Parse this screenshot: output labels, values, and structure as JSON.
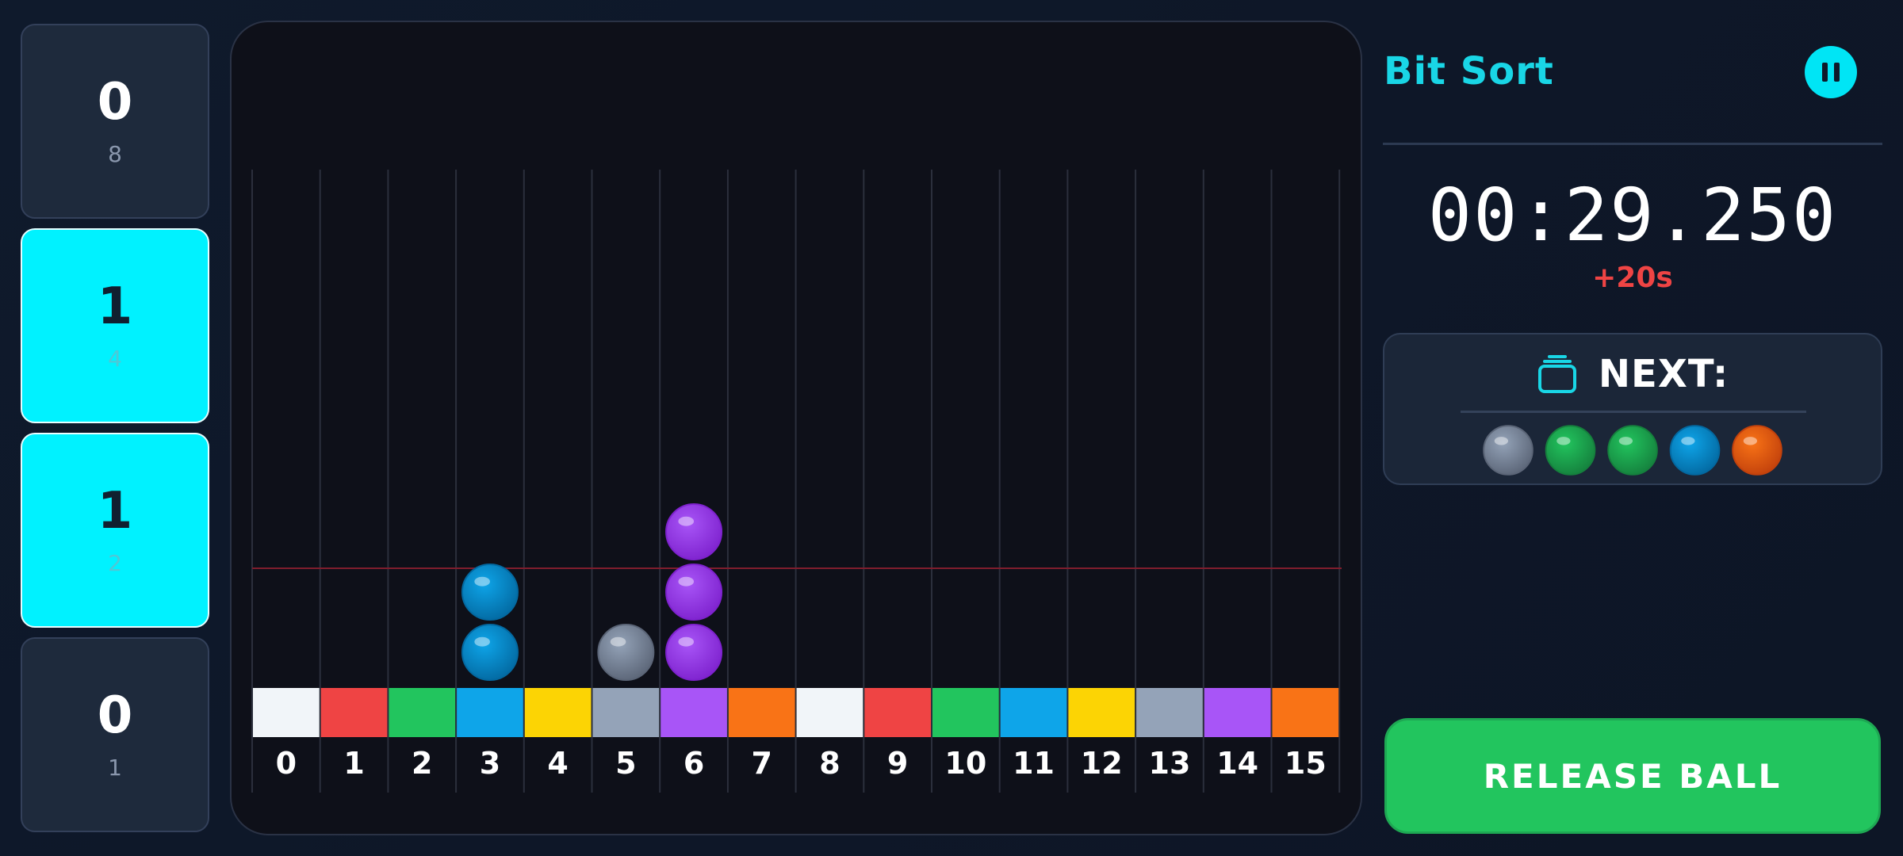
{
  "app": {
    "title": "Bit Sort"
  },
  "bits": [
    {
      "value": "0",
      "weight": "8",
      "active": false
    },
    {
      "value": "1",
      "weight": "4",
      "active": true
    },
    {
      "value": "1",
      "weight": "2",
      "active": true
    },
    {
      "value": "0",
      "weight": "1",
      "active": false
    }
  ],
  "timer": {
    "display": "00:29.250",
    "penalty": "+20s"
  },
  "next": {
    "label": "NEXT:",
    "balls": [
      "gray",
      "green",
      "green",
      "blue",
      "orange"
    ]
  },
  "release_button": {
    "label": "RELEASE BALL"
  },
  "board": {
    "columns": [
      {
        "label": "0",
        "color": "#f1f5f9"
      },
      {
        "label": "1",
        "color": "#ef4444"
      },
      {
        "label": "2",
        "color": "#22c55e"
      },
      {
        "label": "3",
        "color": "#0ea5e9"
      },
      {
        "label": "4",
        "color": "#fcd404"
      },
      {
        "label": "5",
        "color": "#94a3b8"
      },
      {
        "label": "6",
        "color": "#a855f7"
      },
      {
        "label": "7",
        "color": "#f97316"
      },
      {
        "label": "8",
        "color": "#f1f5f9"
      },
      {
        "label": "9",
        "color": "#ef4444"
      },
      {
        "label": "10",
        "color": "#22c55e"
      },
      {
        "label": "11",
        "color": "#0ea5e9"
      },
      {
        "label": "12",
        "color": "#fcd404"
      },
      {
        "label": "13",
        "color": "#94a3b8"
      },
      {
        "label": "14",
        "color": "#a855f7"
      },
      {
        "label": "15",
        "color": "#f97316"
      }
    ],
    "stacks": [
      {
        "column": 3,
        "balls": [
          "blue",
          "blue"
        ]
      },
      {
        "column": 5,
        "balls": [
          "gray"
        ]
      },
      {
        "column": 6,
        "balls": [
          "purple",
          "purple",
          "purple"
        ]
      }
    ],
    "limit_line_color": "#7f1d2d"
  },
  "ball_colors": {
    "blue": {
      "main": "#0ea5e9",
      "dark": "#0369a1"
    },
    "gray": {
      "main": "#94a3b8",
      "dark": "#5b6577"
    },
    "green": {
      "main": "#22c55e",
      "dark": "#15803d"
    },
    "orange": {
      "main": "#f97316",
      "dark": "#c2410c"
    },
    "purple": {
      "main": "#a855f7",
      "dark": "#7e22ce"
    }
  },
  "icons": {
    "pause": "pause-icon",
    "next": "stack-layers-icon"
  }
}
